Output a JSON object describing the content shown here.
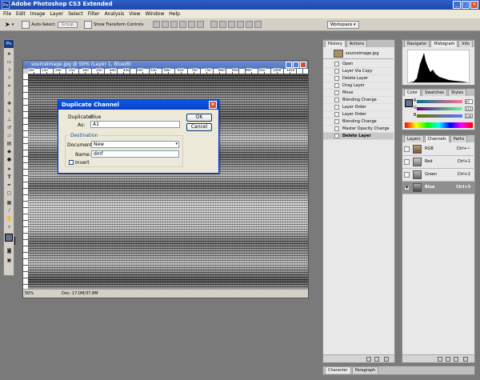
{
  "app": {
    "title": "Adobe Photoshop CS3 Extended",
    "icon_text": "Ps"
  },
  "menu": [
    "File",
    "Edit",
    "Image",
    "Layer",
    "Select",
    "Filter",
    "Analysis",
    "View",
    "Window",
    "Help"
  ],
  "options_bar": {
    "auto_select_label": "Auto-Select:",
    "auto_select_value": "Group",
    "show_transform_label": "Show Transform Controls",
    "workspace_label": "Workspace"
  },
  "toolbox": {
    "logo": "Ps"
  },
  "document": {
    "title": "sourceimage.jpg @ 50% (Layer 1, Blue/8)",
    "zoom": "50%",
    "doc_info": "Doc: 17.0M/37.8M",
    "ruler_numbers": [
      "100",
      "150",
      "200",
      "250",
      "300",
      "350",
      "400",
      "450",
      "500",
      "550",
      "600",
      "650",
      "700",
      "750",
      "800",
      "850",
      "900",
      "950",
      "1000",
      "1050"
    ]
  },
  "dialog": {
    "title": "Duplicate Channel",
    "duplicate_label": "Duplicate:",
    "duplicate_value": "Blue",
    "as_label": "As:",
    "as_value": "A1",
    "destination_label": "Destination",
    "document_label": "Document:",
    "document_value": "New",
    "name_label": "Name:",
    "name_value": "dmf",
    "invert_label": "Invert",
    "ok_label": "OK",
    "cancel_label": "Cancel"
  },
  "history_panel": {
    "tabs": [
      "History",
      "Actions"
    ],
    "snapshot": "sourceimage.jpg",
    "items": [
      "Open",
      "Layer Via Copy",
      "Delete Layer",
      "Drag Layer",
      "Move",
      "Blending Change",
      "Layer Order",
      "Layer Order",
      "Blending Change",
      "Master Opacity Change",
      "Delete Layer"
    ],
    "selected_index": 10
  },
  "navigator_panel": {
    "tabs": [
      "Navigator",
      "Histogram",
      "Info"
    ]
  },
  "color_panel": {
    "tabs": [
      "Color",
      "Swatches",
      "Styles"
    ],
    "rows": [
      {
        "label": "R",
        "value": "97"
      },
      {
        "label": "G",
        "value": "115"
      },
      {
        "label": "B",
        "value": "144"
      }
    ],
    "foreground": "#61738f"
  },
  "channels_panel": {
    "tabs": [
      "Layers",
      "Channels",
      "Paths"
    ],
    "rows": [
      {
        "name": "RGB",
        "shortcut": "Ctrl+~",
        "selected": false
      },
      {
        "name": "Red",
        "shortcut": "Ctrl+1",
        "selected": false
      },
      {
        "name": "Green",
        "shortcut": "Ctrl+2",
        "selected": false
      },
      {
        "name": "Blue",
        "shortcut": "Ctrl+3",
        "selected": true
      }
    ]
  },
  "bottom_panel": {
    "tabs": [
      "Character",
      "Paragraph"
    ]
  }
}
